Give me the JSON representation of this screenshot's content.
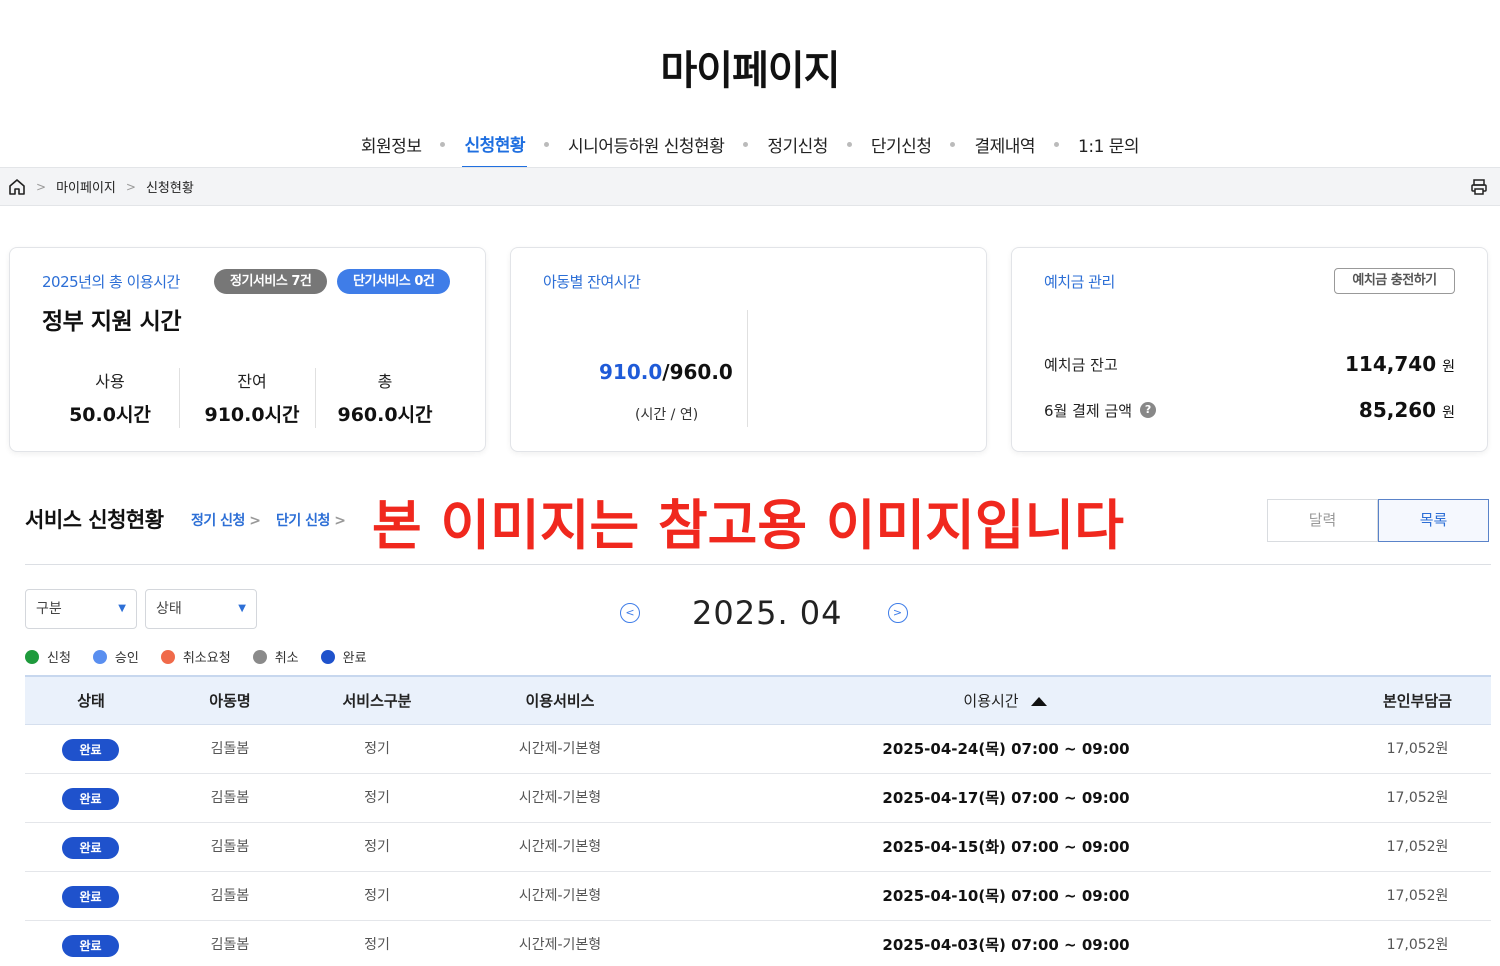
{
  "page": {
    "title": "마이페이지"
  },
  "tabs": [
    {
      "label": "회원정보"
    },
    {
      "label": "신청현황",
      "active": true
    },
    {
      "label": "시니어등하원 신청현황"
    },
    {
      "label": "정기신청"
    },
    {
      "label": "단기신청"
    },
    {
      "label": "결제내역"
    },
    {
      "label": "1:1 문의"
    }
  ],
  "breadcrumb": {
    "home_icon": "home-icon",
    "items": [
      "마이페이지",
      "신청현황"
    ],
    "print_icon": "printer-icon"
  },
  "gov_card": {
    "label": "2025년의 총 이용시간",
    "badge_regular": "정기서비스 7건",
    "badge_short": "단기서비스 0건",
    "title": "정부 지원 시간",
    "stats": [
      {
        "label": "사용",
        "value": "50.0시간"
      },
      {
        "label": "잔여",
        "value": "910.0시간"
      },
      {
        "label": "총",
        "value": "960.0시간"
      }
    ]
  },
  "child_card": {
    "label": "아동별 잔여시간",
    "used": "910.0",
    "total": "/960.0",
    "unit": "(시간 / 연)"
  },
  "deposit_card": {
    "label": "예치금 관리",
    "charge_button": "예치금 충전하기",
    "balance_label": "예치금 잔고",
    "balance_value": "114,740",
    "payment_label": "6월 결제 금액",
    "payment_value": "85,260",
    "currency": "원",
    "help_icon": "?"
  },
  "section": {
    "title": "서비스 신청현황",
    "link_regular": "정기 신청",
    "link_short": "단기 신청",
    "watermark": "본 이미지는 참고용 이미지입니다",
    "view_calendar": "달력",
    "view_list": "목록"
  },
  "filters": {
    "category": "구분",
    "status": "상태"
  },
  "month_nav": {
    "label": "2025. 04",
    "prev_icon": "chevron-left-circle-icon",
    "next_icon": "chevron-right-circle-icon"
  },
  "legend": [
    {
      "label": "신청",
      "color": "#1e9a3c"
    },
    {
      "label": "승인",
      "color": "#5a8ff0"
    },
    {
      "label": "취소요청",
      "color": "#f06a4a"
    },
    {
      "label": "취소",
      "color": "#8a8a8a"
    },
    {
      "label": "완료",
      "color": "#1f52cc"
    }
  ],
  "table": {
    "headers": [
      "상태",
      "아동명",
      "서비스구분",
      "이용서비스",
      "이용시간",
      "본인부담금"
    ],
    "rows": [
      {
        "status": "완료",
        "child": "김돌봄",
        "type": "정기",
        "service": "시간제-기본형",
        "time": "2025-04-24(목) 07:00 ~ 09:00",
        "cost": "17,052원"
      },
      {
        "status": "완료",
        "child": "김돌봄",
        "type": "정기",
        "service": "시간제-기본형",
        "time": "2025-04-17(목) 07:00 ~ 09:00",
        "cost": "17,052원"
      },
      {
        "status": "완료",
        "child": "김돌봄",
        "type": "정기",
        "service": "시간제-기본형",
        "time": "2025-04-15(화) 07:00 ~ 09:00",
        "cost": "17,052원"
      },
      {
        "status": "완료",
        "child": "김돌봄",
        "type": "정기",
        "service": "시간제-기본형",
        "time": "2025-04-10(목) 07:00 ~ 09:00",
        "cost": "17,052원"
      },
      {
        "status": "완료",
        "child": "김돌봄",
        "type": "정기",
        "service": "시간제-기본형",
        "time": "2025-04-03(목) 07:00 ~ 09:00",
        "cost": "17,052원"
      }
    ]
  }
}
